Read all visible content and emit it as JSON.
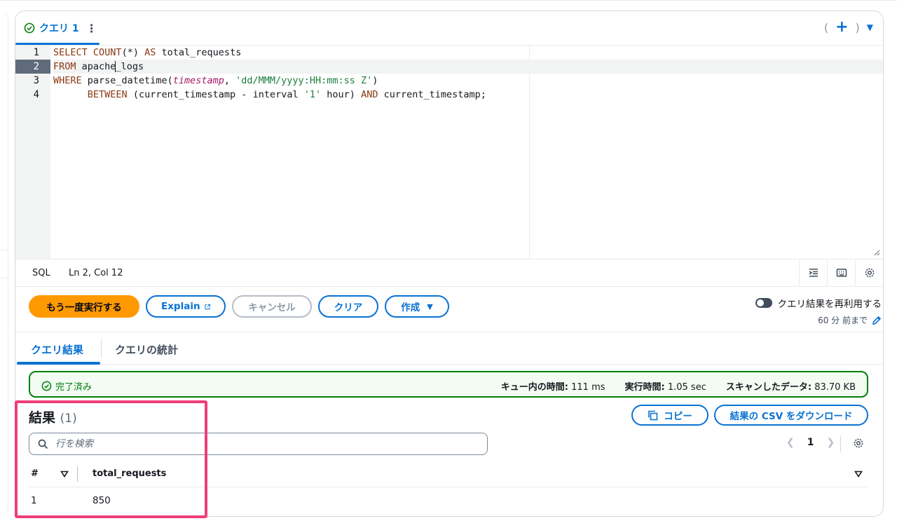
{
  "query_tab": {
    "title": "クエリ 1",
    "menu_icon": "more-vertical-icon"
  },
  "tab_controls": {
    "open_paren": "(",
    "plus": "+",
    "close_paren": ")",
    "caret": "▼"
  },
  "editor": {
    "line_numbers": [
      "1",
      "2",
      "3",
      "4"
    ],
    "active_line": 2,
    "lines": [
      "SELECT COUNT(*) AS total_requests",
      "FROM apache_logs",
      "WHERE parse_datetime(timestamp, 'dd/MMM/yyyy:HH:mm:ss Z')",
      "      BETWEEN (current_timestamp - interval '1' hour) AND current_timestamp;"
    ]
  },
  "status_bar": {
    "language": "SQL",
    "position": "Ln 2, Col 12",
    "icons": [
      "format-icon",
      "keyboard-icon",
      "settings-icon"
    ]
  },
  "actions": {
    "run_again": "もう一度実行する",
    "explain": "Explain",
    "cancel": "キャンセル",
    "clear": "クリア",
    "create": "作成"
  },
  "reuse": {
    "label": "クエリ結果を再利用する",
    "age": "60 分 前まで",
    "enabled": false
  },
  "result_tabs": {
    "results": "クエリ結果",
    "stats": "クエリの統計"
  },
  "execution": {
    "status": "完了済み",
    "queue_label": "キュー内の時間:",
    "queue_value": "111 ms",
    "run_label": "実行時間:",
    "run_value": "1.05 sec",
    "scan_label": "スキャンしたデータ:",
    "scan_value": "83.70 KB"
  },
  "results": {
    "title": "結果",
    "count": "(1)",
    "copy": "コピー",
    "download_csv": "結果の CSV をダウンロード",
    "search_placeholder": "行を検索",
    "page": "1",
    "columns": [
      "#",
      "total_requests"
    ],
    "rows": [
      [
        "1",
        "850"
      ]
    ]
  },
  "colors": {
    "accent": "#0972d3",
    "primary_button": "#ff9900",
    "success": "#037f0c",
    "highlight": "#ef3e7a"
  }
}
